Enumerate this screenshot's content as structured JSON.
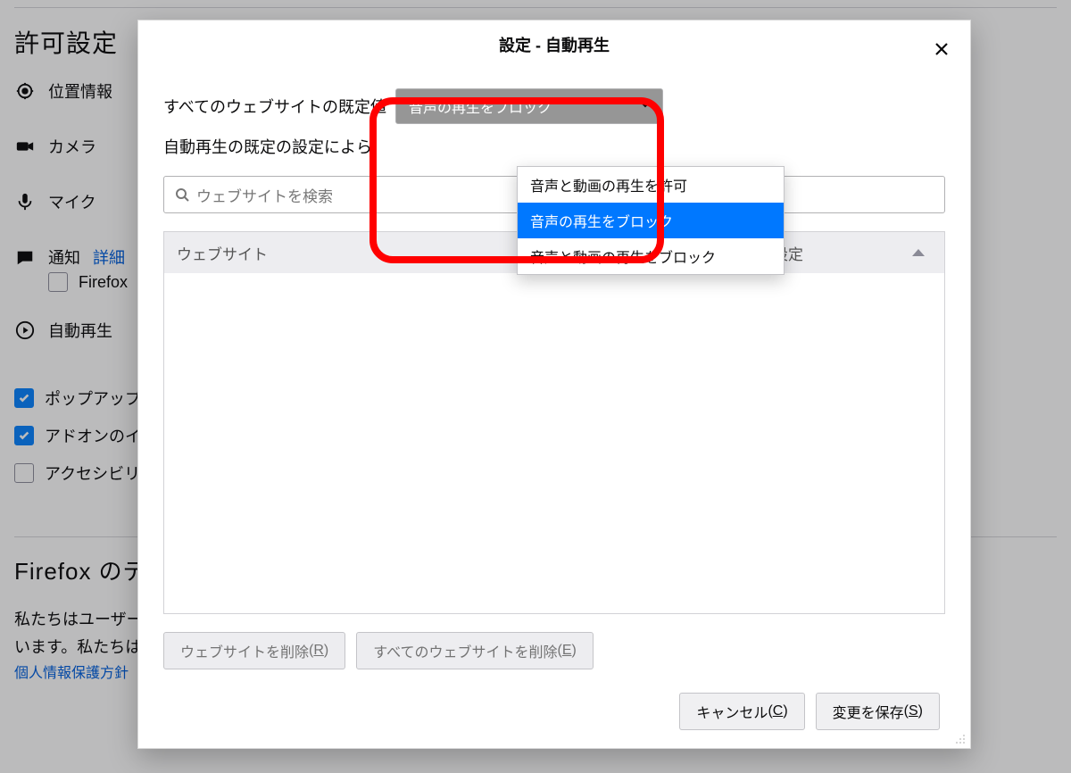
{
  "background": {
    "section_title": "許可設定",
    "items": {
      "location": "位置情報",
      "camera": "カメラ",
      "mic": "マイク",
      "notifications": "通知",
      "notifications_link": "詳細",
      "firefox_chk": "Firefox",
      "autoplay": "自動再生"
    },
    "popups_chk": "ポップアップ",
    "addons_chk": "アドオンのイ",
    "a11y_chk": "アクセシビリ",
    "data_section_title": "Firefox のデ",
    "data_body_line1": "私たちはユーザー",
    "data_body_line2": "います。私たちは",
    "privacy_link": "個人情報保護方針"
  },
  "dialog": {
    "title": "設定 - 自動再生",
    "default_label": "すべてのウェブサイトの既定値",
    "select_current": "音声の再生をブロック",
    "options": [
      "音声と動画の再生を許可",
      "音声の再生をブロック",
      "音声と動画の再生をブロック"
    ],
    "desc": "自動再生の既定の設定によら",
    "search_placeholder": "ウェブサイトを検索",
    "col_site": "ウェブサイト",
    "col_setting": "現在の設定",
    "remove_site_btn": "ウェブサイトを削除",
    "remove_site_key": "R",
    "remove_all_btn": "すべてのウェブサイトを削除",
    "remove_all_key": "E",
    "cancel_btn": "キャンセル",
    "cancel_key": "C",
    "save_btn": "変更を保存",
    "save_key": "S"
  }
}
